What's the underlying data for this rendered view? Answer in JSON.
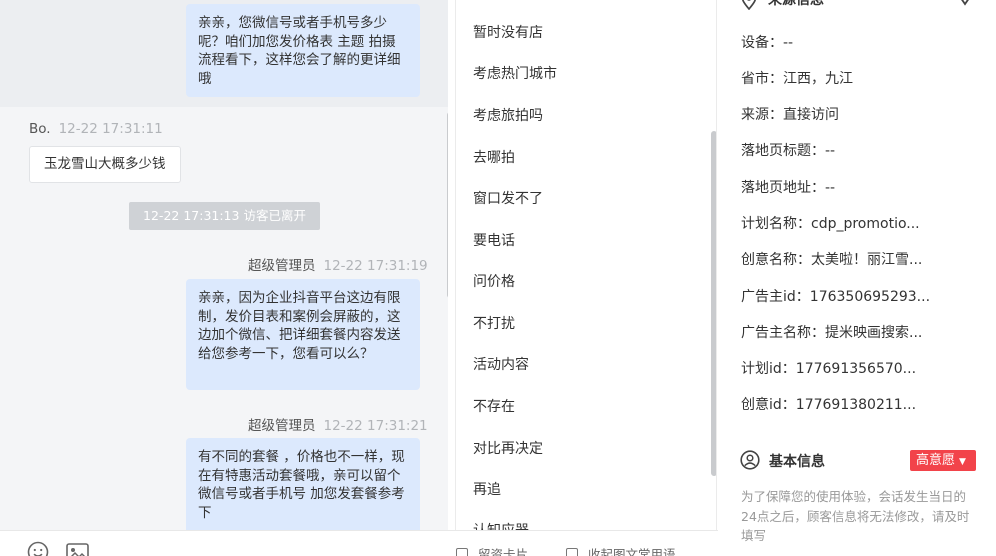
{
  "chat": {
    "messages": [
      {
        "type": "agent",
        "text": "亲亲，您微信号或者手机号多少呢？咱们加您发价格表 主题 拍摄流程看下，这样您会了解的更详细哦"
      },
      {
        "type": "visitor",
        "sender": "Bo.",
        "time": "12-22 17:31:11",
        "text": "玉龙雪山大概多少钱"
      },
      {
        "type": "system",
        "text": "12-22 17:31:13 访客已离开"
      },
      {
        "type": "agent",
        "sender": "超级管理员",
        "time": "12-22 17:31:19",
        "text": "亲亲，因为企业抖音平台这边有限制，发价目表和案例会屏蔽的，这边加个微信、把详细套餐内容发送给您参考一下，您看可以么？"
      },
      {
        "type": "agent",
        "sender": "超级管理员",
        "time": "12-22 17:31:21",
        "text": "有不同的套餐 ，价格也不一样，现在有特惠活动套餐哦，亲可以留个微信号或者手机号 加您发套餐参考下"
      }
    ]
  },
  "toolbar": {
    "emoji_icon": "smiley-icon",
    "image_icon": "image-icon",
    "leave_card": "留资卡片",
    "collapse_quick": "收起图文常用语"
  },
  "quick_replies": [
    "暂时没有店",
    "考虑热门城市",
    "考虑旅拍吗",
    "去哪拍",
    "窗口发不了",
    "要电话",
    "问价格",
    "不打扰",
    "活动内容",
    "不存在",
    "对比再决定",
    "再追",
    "认知应器"
  ],
  "info": {
    "source_title": "来源信息",
    "rows": [
      {
        "label": "设备：",
        "value": "--"
      },
      {
        "label": "省市：",
        "value": "江西，九江"
      },
      {
        "label": "来源：",
        "value": "直接访问"
      },
      {
        "label": "落地页标题：",
        "value": "--"
      },
      {
        "label": "落地页地址：",
        "value": "--"
      },
      {
        "label": "计划名称：",
        "value": "cdp_promotio..."
      },
      {
        "label": "创意名称：",
        "value": "太美啦！丽江雪..."
      },
      {
        "label": "广告主id：",
        "value": "176350695293..."
      },
      {
        "label": "广告主名称：",
        "value": "提米映画搜索..."
      },
      {
        "label": "计划id：",
        "value": "177691356570..."
      },
      {
        "label": "创意id：",
        "value": "177691380211..."
      }
    ],
    "basic_title": "基本信息",
    "intent_badge": "高意愿",
    "note": "为了保障您的使用体验，会话发生当日的24点之后，顾客信息将无法修改，请及时填写",
    "colors": {
      "agent_bubble": "#dce9fd",
      "badge": "#f2434a"
    }
  }
}
